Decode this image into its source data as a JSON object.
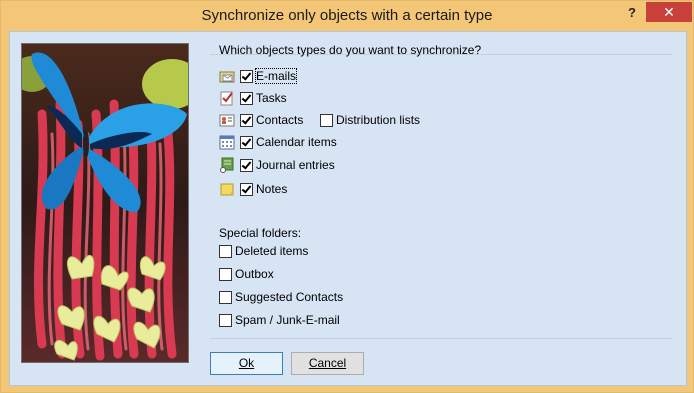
{
  "window": {
    "title": "Synchronize only objects with a certain type",
    "help_label": "?",
    "close_label": "✕"
  },
  "types": {
    "question": "Which objects types do you want to synchronize?",
    "items": [
      {
        "label": "E-mails",
        "checked": true,
        "icon": "email-folder-icon"
      },
      {
        "label": "Tasks",
        "checked": true,
        "icon": "tasks-icon"
      },
      {
        "label": "Contacts",
        "checked": true,
        "icon": "contacts-icon"
      },
      {
        "label": "Calendar items",
        "checked": true,
        "icon": "calendar-icon"
      },
      {
        "label": "Journal entries",
        "checked": true,
        "icon": "journal-icon"
      },
      {
        "label": "Notes",
        "checked": true,
        "icon": "notes-icon"
      }
    ],
    "distribution": {
      "label": "Distribution lists",
      "checked": false
    }
  },
  "special": {
    "heading": "Special folders:",
    "items": [
      {
        "label": "Deleted items",
        "checked": false
      },
      {
        "label": "Outbox",
        "checked": false
      },
      {
        "label": "Suggested Contacts",
        "checked": false
      },
      {
        "label": "Spam / Junk-E-mail",
        "checked": false
      }
    ]
  },
  "buttons": {
    "ok_label": "Ok",
    "cancel_label": "Cancel"
  },
  "colors": {
    "title_bar": "#f4c778",
    "client_background": "#d6e4f4",
    "close_button": "#c7403a"
  }
}
